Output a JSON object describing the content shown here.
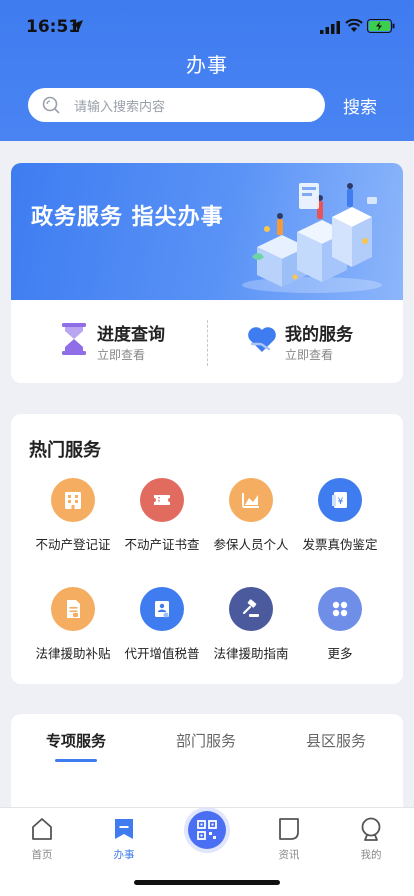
{
  "status_bar": {
    "time": "16:51"
  },
  "header": {
    "title": "办事",
    "search_placeholder": "请输入搜索内容",
    "search_label": "搜索"
  },
  "banner": {
    "text": "政务服务 指尖办事"
  },
  "quick_links": [
    {
      "title": "进度查询",
      "subtitle": "立即查看",
      "icon": "hourglass-icon",
      "color": "#8f6ee8"
    },
    {
      "title": "我的服务",
      "subtitle": "立即查看",
      "icon": "heart-hand-icon",
      "color": "#3f7cf0"
    }
  ],
  "hot_services": {
    "title": "热门服务",
    "items": [
      {
        "label": "不动产登记证",
        "icon": "building-icon",
        "color": "#f4ad61"
      },
      {
        "label": "不动产证书查",
        "icon": "ticket-icon",
        "color": "#e26b5f"
      },
      {
        "label": "参保人员个人",
        "icon": "chart-icon",
        "color": "#f4ad61"
      },
      {
        "label": "发票真伪鉴定",
        "icon": "invoice-icon",
        "color": "#3f7cf0"
      },
      {
        "label": "法律援助补贴",
        "icon": "document-icon",
        "color": "#f4ad61"
      },
      {
        "label": "代开增值税普",
        "icon": "id-card-icon",
        "color": "#3f7cf0"
      },
      {
        "label": "法律援助指南",
        "icon": "gavel-icon",
        "color": "#4b5a9c"
      },
      {
        "label": "更多",
        "icon": "more-icon",
        "color": "#6f8ee8"
      }
    ]
  },
  "service_tabs": [
    {
      "label": "专项服务",
      "active": true
    },
    {
      "label": "部门服务",
      "active": false
    },
    {
      "label": "县区服务",
      "active": false
    }
  ],
  "bottom_nav": [
    {
      "label": "首页",
      "icon": "home-icon",
      "active": false
    },
    {
      "label": "办事",
      "icon": "bookmark-icon",
      "active": true
    },
    {
      "label": "资讯",
      "icon": "news-icon",
      "active": false
    },
    {
      "label": "我的",
      "icon": "user-icon",
      "active": false
    }
  ]
}
